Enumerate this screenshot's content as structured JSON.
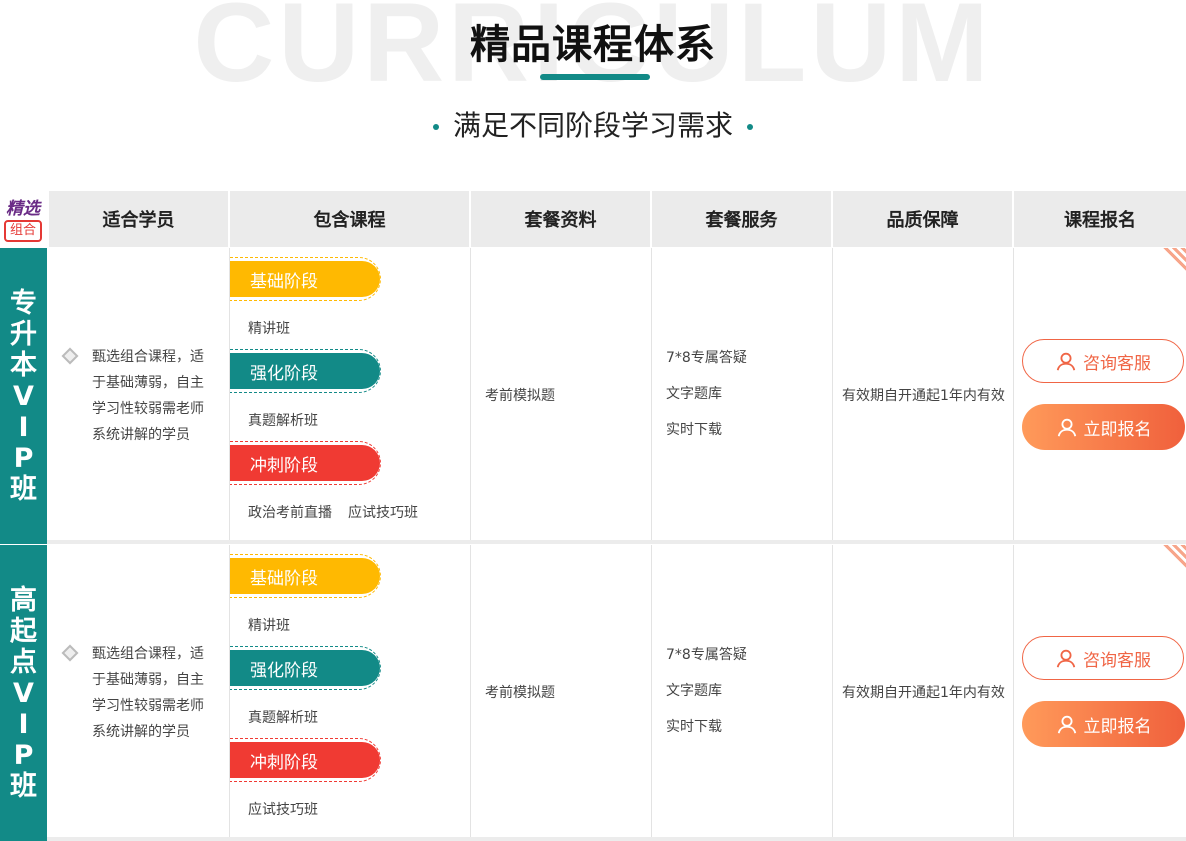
{
  "header": {
    "bg_word": "CURRICULUM",
    "title": "精品课程体系",
    "subtitle": "满足不同阶段学习需求",
    "accent": "#128a87"
  },
  "badge": {
    "line1": "精选",
    "line2": "组合"
  },
  "columns": [
    "适合学员",
    "包含课程",
    "套餐资料",
    "套餐服务",
    "品质保障",
    "课程报名"
  ],
  "rows": [
    {
      "label_chars": [
        "专",
        "升",
        "本",
        "V",
        "I",
        "P",
        "班"
      ],
      "audience": "甄选组合课程，适于基础薄弱，自主学习性较弱需老师系统讲解的学员",
      "stages": [
        {
          "name": "基础阶段",
          "color": "#ffb901",
          "courses": [
            "精讲班"
          ]
        },
        {
          "name": "强化阶段",
          "color": "#128a87",
          "courses": [
            "真题解析班"
          ]
        },
        {
          "name": "冲刺阶段",
          "color": "#f03a33",
          "courses": [
            "政治考前直播",
            "应试技巧班"
          ]
        }
      ],
      "material": "考前模拟题",
      "services": [
        "7*8专属答疑",
        "文字题库",
        "实时下载"
      ],
      "quality": "有效期自开通起1年内有效",
      "consult_label": "咨询客服",
      "signup_label": "立即报名"
    },
    {
      "label_chars": [
        "高",
        "起",
        "点",
        "V",
        "I",
        "P",
        "班"
      ],
      "audience": "甄选组合课程，适于基础薄弱，自主学习性较弱需老师系统讲解的学员",
      "stages": [
        {
          "name": "基础阶段",
          "color": "#ffb901",
          "courses": [
            "精讲班"
          ]
        },
        {
          "name": "强化阶段",
          "color": "#128a87",
          "courses": [
            "真题解析班"
          ]
        },
        {
          "name": "冲刺阶段",
          "color": "#f03a33",
          "courses": [
            "应试技巧班"
          ]
        }
      ],
      "material": "考前模拟题",
      "services": [
        "7*8专属答疑",
        "文字题库",
        "实时下载"
      ],
      "quality": "有效期自开通起1年内有效",
      "consult_label": "咨询客服",
      "signup_label": "立即报名"
    }
  ]
}
